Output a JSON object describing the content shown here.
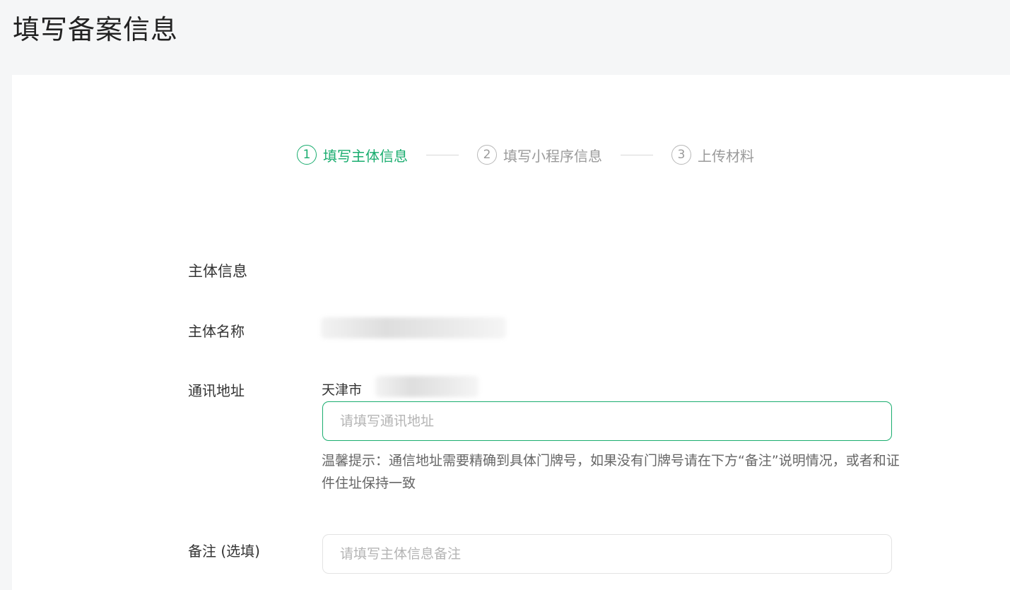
{
  "page": {
    "title": "填写备案信息"
  },
  "steps": [
    {
      "number": "1",
      "label": "填写主体信息",
      "active": true
    },
    {
      "number": "2",
      "label": "填写小程序信息",
      "active": false
    },
    {
      "number": "3",
      "label": "上传材料",
      "active": false
    }
  ],
  "form": {
    "section_title": "主体信息",
    "subject_name_label": "主体名称",
    "address_label": "通讯地址",
    "address_prefix": "天津市",
    "address_placeholder": "请填写通讯地址",
    "address_hint": "温馨提示：通信地址需要精确到具体门牌号，如果没有门牌号请在下方“备注”说明情况，或者和证件住址保持一致",
    "remark_label": "备注 (选填)",
    "remark_placeholder": "请填写主体信息备注"
  },
  "colors": {
    "accent": "#1aad6f",
    "inactive": "#9a9a9a",
    "background": "#f5f6f7"
  }
}
